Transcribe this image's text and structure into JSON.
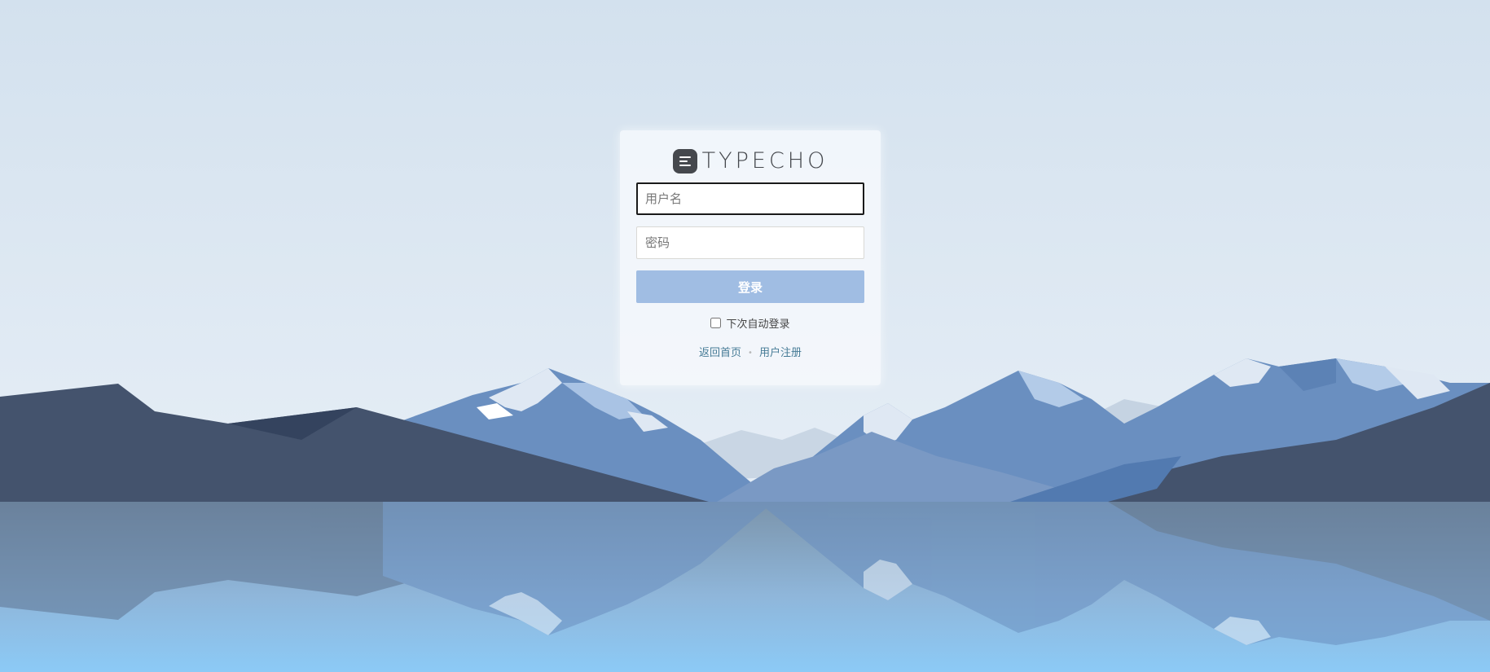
{
  "brand": {
    "name": "TYPECHO",
    "logo_icon": "typecho-logo-icon"
  },
  "form": {
    "username_placeholder": "用户名",
    "username_value": "",
    "password_placeholder": "密码",
    "password_value": "",
    "submit_label": "登录",
    "remember_label": "下次自动登录",
    "remember_checked": false
  },
  "links": {
    "home_label": "返回首页",
    "separator": "•",
    "register_label": "用户注册"
  },
  "colors": {
    "sky_top": "#d3e1ee",
    "sky_bottom": "#e4edf5",
    "water_top": "#7e98b0",
    "water_bottom": "#8cc8f4",
    "button": "#a0bde3",
    "link": "#467b96",
    "mountain_dark": "#44536d",
    "mountain_blue": "#6a8fc0"
  }
}
